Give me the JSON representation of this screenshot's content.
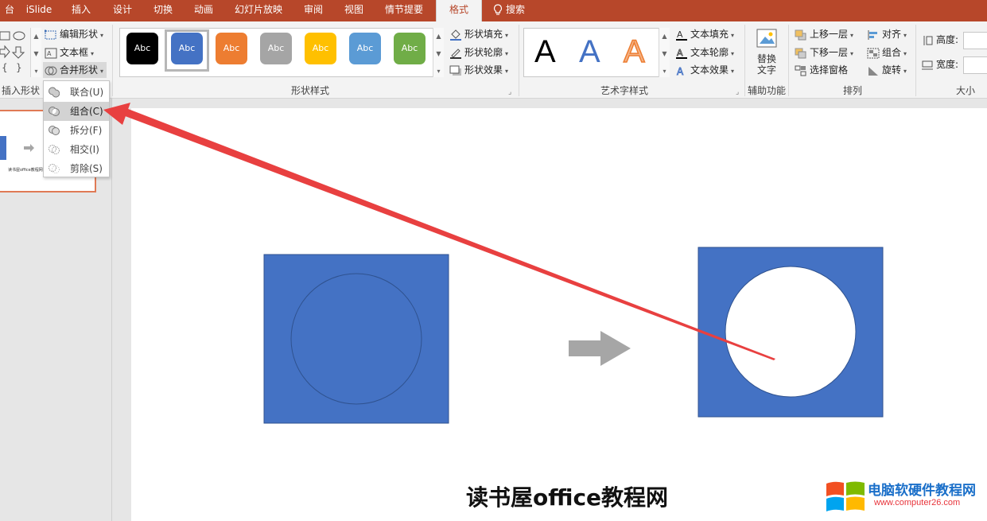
{
  "tabs": [
    "台",
    "iSlide",
    "插入",
    "设计",
    "切换",
    "动画",
    "幻灯片放映",
    "审阅",
    "视图",
    "情节提要",
    "格式"
  ],
  "active_tab": "格式",
  "tell_me": "搜索",
  "insert_shapes": {
    "edit_shape": "编辑形状",
    "text_box": "文本框",
    "merge_shapes": "合并形状",
    "group_label": "插入形状"
  },
  "shape_styles": {
    "swatches": [
      {
        "label": "Abc",
        "color": "#000000"
      },
      {
        "label": "Abc",
        "color": "#4472c4"
      },
      {
        "label": "Abc",
        "color": "#ed7d31"
      },
      {
        "label": "Abc",
        "color": "#a5a5a5"
      },
      {
        "label": "Abc",
        "color": "#ffc000"
      },
      {
        "label": "Abc",
        "color": "#5b9bd5"
      },
      {
        "label": "Abc",
        "color": "#70ad47"
      }
    ],
    "fill": "形状填充",
    "outline": "形状轮廓",
    "effects": "形状效果",
    "group_label": "形状样式"
  },
  "wordart": {
    "samples": [
      "A",
      "A",
      "A"
    ],
    "text_fill": "文本填充",
    "text_outline": "文本轮廓",
    "text_effects": "文本效果",
    "group_label": "艺术字样式"
  },
  "accessibility": {
    "alt_text_line1": "替换",
    "alt_text_line2": "文字",
    "group_label": "辅助功能"
  },
  "arrange": {
    "bring_forward": "上移一层",
    "send_backward": "下移一层",
    "selection_pane": "选择窗格",
    "align": "对齐",
    "group": "组合",
    "rotate": "旋转",
    "group_label": "排列"
  },
  "size": {
    "height_label": "高度:",
    "width_label": "宽度:",
    "group_label": "大小"
  },
  "merge_menu": [
    {
      "label": "联合(U)",
      "highlighted": false
    },
    {
      "label": "组合(C)",
      "highlighted": true
    },
    {
      "label": "拆分(F)",
      "highlighted": false
    },
    {
      "label": "相交(I)",
      "highlighted": false
    },
    {
      "label": "剪除(S)",
      "highlighted": false
    }
  ],
  "thumbnail_caption": "读书屋office教程网",
  "watermark": "读书屋office教程网",
  "site_logo": {
    "name": "电脑软硬件教程网",
    "url": "www.computer26.com"
  },
  "colors": {
    "accent": "#b7472a",
    "shape_blue": "#4472c4",
    "arrow_gray": "#a6a6a6",
    "annotation_red": "#e84040"
  }
}
